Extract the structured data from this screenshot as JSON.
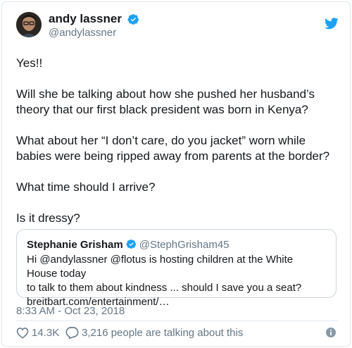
{
  "author": {
    "display_name": "andy lassner",
    "handle": "@andylassner",
    "verified": true
  },
  "tweet": {
    "paragraphs": [
      "Yes!!",
      "Will she be talking about how she pushed her husband’s theory that our first black president was born in Kenya?",
      "What about her “I don’t care, do you jacket” worn while babies were being ripped away from parents at the border?",
      "What time should I arrive?",
      "Is it dressy?"
    ]
  },
  "quoted_tweet": {
    "display_name": "Stephanie Grisham",
    "handle": "@StephGrisham45",
    "verified": true,
    "text_line1": "Hi @andylassner @flotus is hosting children at the White House today",
    "text_line2": "to talk to them about kindness ... should I save you a seat?",
    "text_line3": "breitbart.com/entertainment/…"
  },
  "meta": {
    "timestamp": "8:33 AM - Oct 23, 2018",
    "likes": "14.3K",
    "talking": "3,216 people are talking about this"
  },
  "icons": {
    "bird": "twitter-bird-icon",
    "verified": "verified-badge-icon",
    "like": "heart-icon",
    "reply": "reply-bubble-icon",
    "info": "info-icon"
  },
  "colors": {
    "twitter_blue": "#1da1f2",
    "text": "#14171a",
    "secondary": "#657786",
    "border": "#e1e8ed"
  }
}
